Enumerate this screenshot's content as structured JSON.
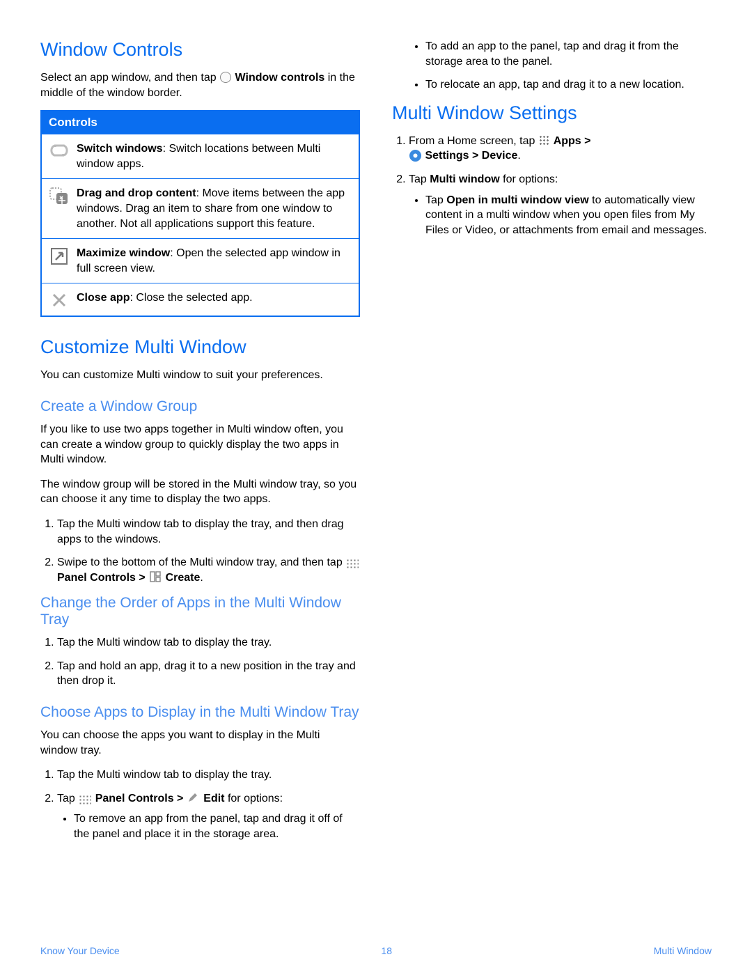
{
  "h1_window_controls": "Window Controls",
  "wc_intro_1": "Select an app window, and then tap",
  "wc_intro_2_bold": "Window controls",
  "wc_intro_3": " in the middle of the window border.",
  "controls_header": "Controls",
  "ctl1_bold": "Switch windows",
  "ctl1_text": ": Switch locations between Multi window apps.",
  "ctl2_bold": "Drag and drop content",
  "ctl2_text": ": Move items between the app windows. Drag an item to share from one window to another. Not all applications support this feature.",
  "ctl3_bold": "Maximize window",
  "ctl3_text": ": Open the selected app window in full screen view.",
  "ctl4_bold": "Close app",
  "ctl4_text": ": Close the selected app.",
  "h1_customize": "Customize Multi Window",
  "customize_p": "You can customize Multi window to suit your preferences.",
  "h2_create_group": "Create a Window Group",
  "cg_p1": "If you like to use two apps together in Multi window often, you can create a window group to quickly display the two apps in Multi window.",
  "cg_p2": "The window group will be stored in the Multi window tray, so you can choose it any time to display the two apps.",
  "cg_li1": "Tap the Multi window tab to display the tray, and then drag apps to the windows.",
  "cg_li2_a": "Swipe to the bottom of the Multi window tray, and then tap ",
  "cg_li2_b_bold": "Panel Controls > ",
  "cg_li2_c_bold": " Create",
  "cg_li2_dot": ".",
  "h2_change_order": "Change the Order of Apps in the Multi Window Tray",
  "co_li1": "Tap the Multi window tab to display the tray.",
  "co_li2": "Tap and hold an app, drag it to a new position in the tray and then drop it.",
  "h2_choose_apps": "Choose Apps to Display in the Multi Window Tray",
  "ca_p": "You can choose the apps you want to display in the Multi window tray.",
  "ca_li1": "Tap the Multi window tab to display the tray.",
  "ca_li2_a": "Tap ",
  "ca_li2_b_bold": " Panel Controls > ",
  "ca_li2_c_bold": " Edit",
  "ca_li2_d": " for options:",
  "ca_sub1": "To remove an app from the panel, tap and drag it off of the panel and place it in the storage area.",
  "ca_sub2": "To add an app to the panel, tap and drag it from the storage area to the panel.",
  "ca_sub3": "To relocate an app, tap and drag it to a new location.",
  "h1_settings": "Multi Window Settings",
  "ms_li1_a": "From a Home screen, tap ",
  "ms_li1_b_bold": " Apps > ",
  "ms_li1_c_bold": " Settings > Device",
  "ms_li1_dot": ".",
  "ms_li2_a": "Tap ",
  "ms_li2_b_bold": "Multi window",
  "ms_li2_c": " for options:",
  "ms_sub_a": "Tap ",
  "ms_sub_b_bold": "Open in multi window view",
  "ms_sub_c": " to automatically view content in a multi window when you open files from My Files or Video, or attachments from email and messages.",
  "footer_left": "Know Your Device",
  "footer_page": "18",
  "footer_right": "Multi Window"
}
